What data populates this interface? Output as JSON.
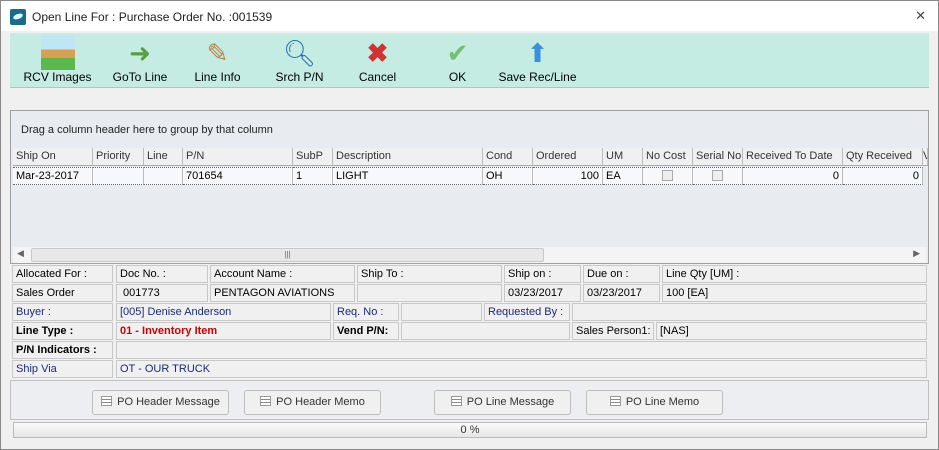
{
  "window": {
    "title": "Open Line For : Purchase Order No. :001539"
  },
  "toolbar": [
    {
      "label": "RCV Images",
      "icon": "images-icon"
    },
    {
      "label": "GoTo Line",
      "icon": "goto-icon"
    },
    {
      "label": "Line Info",
      "icon": "notepad-icon"
    },
    {
      "label": "Srch P/N",
      "icon": "magnifier-icon"
    },
    {
      "label": "Cancel",
      "icon": "x-icon"
    },
    {
      "label": "OK",
      "icon": "check-icon"
    },
    {
      "label": "Save Rec/Line",
      "icon": "up-arrow-icon"
    }
  ],
  "grid": {
    "group_hint": "Drag a column header here to group by that column",
    "columns": [
      "Ship On",
      "Priority",
      "Line",
      "P/N",
      "SubP",
      "Description",
      "Cond",
      "Ordered",
      "UM",
      "No Cost",
      "Serial No.",
      "Received To Date",
      "Qty Received",
      "V"
    ],
    "rows": [
      {
        "ship_on": "Mar-23-2017",
        "priority": "",
        "line": "",
        "pn": "701654",
        "subp": "1",
        "description": "LIGHT",
        "cond": "OH",
        "ordered": "100",
        "um": "EA",
        "no_cost": false,
        "serial_no": false,
        "received_to_date": "0",
        "qty_received": "0"
      }
    ]
  },
  "details": {
    "allocated_for_label": "Allocated For :",
    "allocated_for": "Sales Order",
    "doc_no_label": "Doc No. :",
    "doc_no": "001773",
    "account_name_label": "Account Name :",
    "account_name": "PENTAGON AVIATIONS",
    "ship_to_label": "Ship To :",
    "ship_to": "",
    "ship_on_label": "Ship on :",
    "ship_on": "03/23/2017",
    "due_on_label": "Due on :",
    "due_on": "03/23/2017",
    "line_qty_label": "Line Qty [UM] :",
    "line_qty": "100 [EA]",
    "buyer_label": "Buyer :",
    "buyer": "[005] Denise Anderson",
    "req_no_label": "Req. No :",
    "req_no": "",
    "requested_by_label": "Requested By :",
    "requested_by": "",
    "line_type_label": "Line Type :",
    "line_type": "01 - Inventory Item",
    "vend_pn_label": "Vend P/N:",
    "vend_pn": "",
    "sales_person_label": "Sales Person1:",
    "sales_person": "[NAS]",
    "pn_indicators_label": "P/N Indicators :",
    "pn_indicators": "",
    "ship_via_label": "Ship Via",
    "ship_via": "OT - OUR TRUCK"
  },
  "buttons": {
    "po_header_message": "PO Header Message",
    "po_header_memo": "PO Header Memo",
    "po_line_message": "PO Line Message",
    "po_line_memo": "PO Line Memo"
  },
  "progress": {
    "value": 0,
    "label": "0 %"
  },
  "colors": {
    "toolbar_bg": "#c4ece2",
    "line_type": "#cc0000",
    "blue_label": "#1a2a7a"
  }
}
